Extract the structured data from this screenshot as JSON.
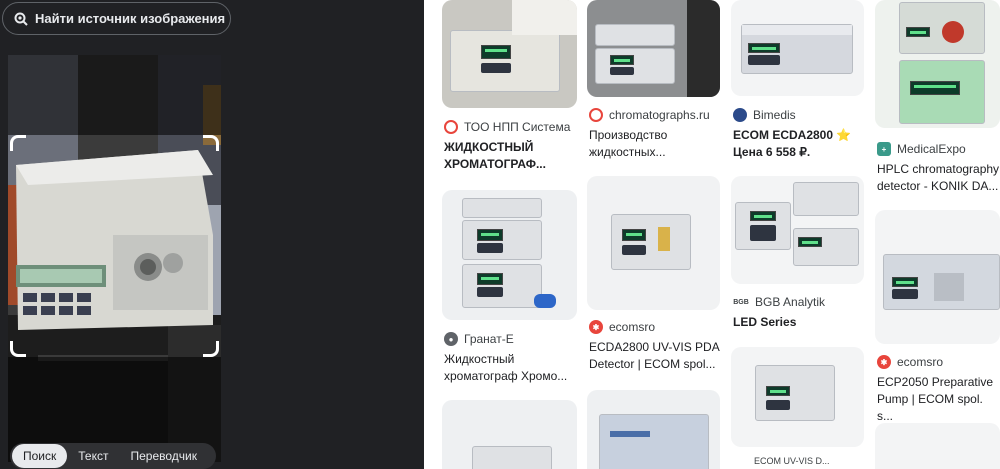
{
  "left_panel": {
    "find_source_label": "Найти источник изображения",
    "tabs": [
      {
        "label": "Поиск",
        "active": true
      },
      {
        "label": "Текст",
        "active": false
      },
      {
        "label": "Переводчик",
        "active": false
      }
    ]
  },
  "results": [
    {
      "source": "ТОО НПП Система",
      "title": "ЖИДКОСТНЫЙ ХРОМАТОГРАФ...",
      "favicon_color": "#e8453c"
    },
    {
      "source": "chromatographs.ru",
      "title": "Производство жидкостных...",
      "favicon_color": "#e8453c"
    },
    {
      "source": "Bimedis",
      "title": "ECOM ECDA2800 ⭐ Цена 6 558 ₽.",
      "favicon_color": "#2b4a8a"
    },
    {
      "source": "MedicalExpo",
      "title": "HPLC chromatography detector - KONIK DA...",
      "favicon_color": "#3a9a8a"
    },
    {
      "source": "Гранат-Е",
      "title": "Жидкостный хроматограф Хромо...",
      "favicon_color": "#5f6368"
    },
    {
      "source": "ecomsro",
      "title": "ECDA2800 UV-VIS PDA Detector | ECOM spol...",
      "favicon_color": "#e8453c"
    },
    {
      "source": "BGB Analytik",
      "title": "LED Series",
      "favicon_color": "#ffffff",
      "favicon_text": "BGB"
    },
    {
      "source": "ecomsro",
      "title": "ECP2050 Preparative Pump | ECOM spol. s...",
      "favicon_color": "#e8453c"
    }
  ],
  "partial_caption": "ECOM UV-VIS D..."
}
